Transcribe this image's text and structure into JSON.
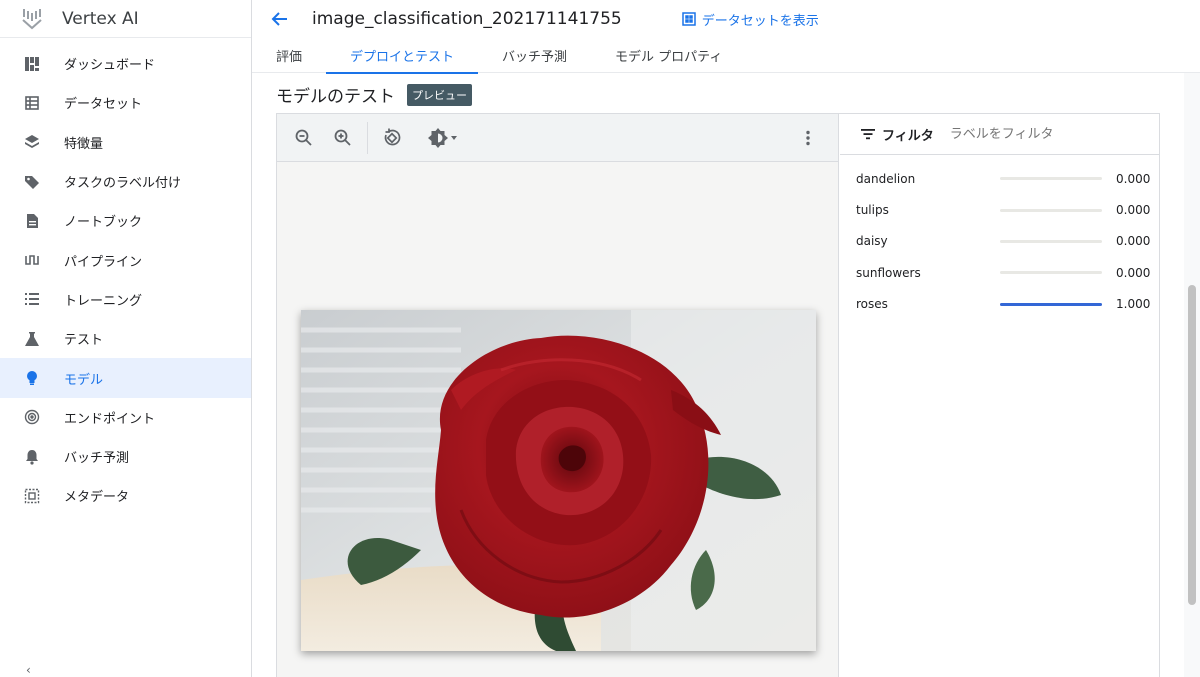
{
  "brand": {
    "title": "Vertex AI"
  },
  "sidebar": {
    "items": [
      {
        "label": "ダッシュボード",
        "icon": "dashboard-icon"
      },
      {
        "label": "データセット",
        "icon": "dataset-icon"
      },
      {
        "label": "特徴量",
        "icon": "features-icon"
      },
      {
        "label": "タスクのラベル付け",
        "icon": "label-tag-icon"
      },
      {
        "label": "ノートブック",
        "icon": "notebook-icon"
      },
      {
        "label": "パイプライン",
        "icon": "pipeline-icon"
      },
      {
        "label": "トレーニング",
        "icon": "training-list-icon"
      },
      {
        "label": "テスト",
        "icon": "flask-icon"
      },
      {
        "label": "モデル",
        "icon": "lightbulb-icon",
        "active": true
      },
      {
        "label": "エンドポイント",
        "icon": "endpoint-icon"
      },
      {
        "label": "バッチ予測",
        "icon": "bell-icon"
      },
      {
        "label": "メタデータ",
        "icon": "metadata-icon"
      }
    ]
  },
  "header": {
    "model_name": "image_classification_202171141755",
    "view_dataset": "データセットを表示"
  },
  "tabs": [
    {
      "label": "評価"
    },
    {
      "label": "デプロイとテスト",
      "active": true
    },
    {
      "label": "バッチ予測"
    },
    {
      "label": "モデル プロパティ"
    }
  ],
  "section": {
    "title": "モデルのテスト",
    "badge": "プレビュー"
  },
  "filter": {
    "label": "フィルタ",
    "placeholder": "ラベルをフィルタ"
  },
  "predictions": [
    {
      "label": "dandelion",
      "score_text": "0.000",
      "score": 0.0
    },
    {
      "label": "tulips",
      "score_text": "0.000",
      "score": 0.0
    },
    {
      "label": "daisy",
      "score_text": "0.000",
      "score": 0.0
    },
    {
      "label": "sunflowers",
      "score_text": "0.000",
      "score": 0.0
    },
    {
      "label": "roses",
      "score_text": "1.000",
      "score": 1.0
    }
  ],
  "colors": {
    "accent": "#1a73e8",
    "bar_fill": "#3367d6",
    "badge_bg": "#455a64"
  }
}
